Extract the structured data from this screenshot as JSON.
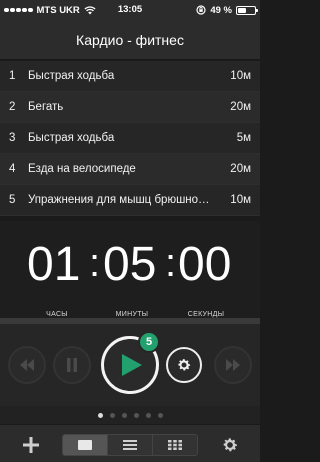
{
  "status_bar": {
    "carrier": "MTS UKR",
    "time": "13:05",
    "battery_text": "49 %",
    "battery_level": 0.49
  },
  "header": {
    "title": "Кардио - фитнес"
  },
  "exercises": [
    {
      "num": "1",
      "name": "Быстрая ходьба",
      "duration": "10м"
    },
    {
      "num": "2",
      "name": "Бегать",
      "duration": "20м"
    },
    {
      "num": "3",
      "name": "Быстрая ходьба",
      "duration": "5м"
    },
    {
      "num": "4",
      "name": "Езда на велосипеде",
      "duration": "20м"
    },
    {
      "num": "5",
      "name": "Упражнения для мышц брюшного пресса",
      "duration": "10м"
    }
  ],
  "timer": {
    "hours": "01",
    "minutes": "05",
    "seconds": "00",
    "hours_label": "ЧАСЫ",
    "minutes_label": "МИНУТЫ",
    "seconds_label": "СЕКУНДЫ"
  },
  "progress": {
    "fraction": 0.0
  },
  "controls": {
    "badge_count": "5",
    "accent_color": "#22a06e"
  },
  "pager": {
    "count": 6,
    "active_index": 0
  },
  "icons": [
    "rewind-icon",
    "pause-icon",
    "play-icon",
    "gear-icon",
    "fast-forward-icon",
    "plus-icon",
    "card-view-icon",
    "list-view-icon",
    "grid-view-icon",
    "settings-icon"
  ]
}
